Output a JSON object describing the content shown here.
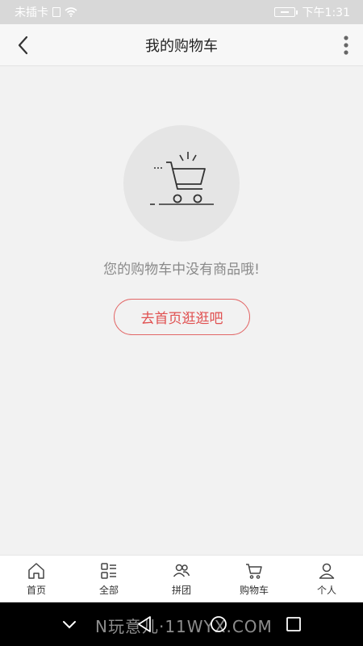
{
  "status_bar": {
    "carrier": "未插卡",
    "time": "下午1:31"
  },
  "header": {
    "title": "我的购物车"
  },
  "empty_state": {
    "message": "您的购物车中没有商品哦!",
    "button_label": "去首页逛逛吧"
  },
  "tabs": [
    {
      "label": "首页",
      "icon": "home-icon"
    },
    {
      "label": "全部",
      "icon": "category-list-icon"
    },
    {
      "label": "拼团",
      "icon": "group-users-icon"
    },
    {
      "label": "购物车",
      "icon": "cart-icon"
    },
    {
      "label": "个人",
      "icon": "person-icon"
    }
  ],
  "watermark": "N玩意儿·11WYX.COM",
  "colors": {
    "accent": "#e05050",
    "background": "#f2f2f2",
    "status_bar": "#d8d8d8"
  }
}
